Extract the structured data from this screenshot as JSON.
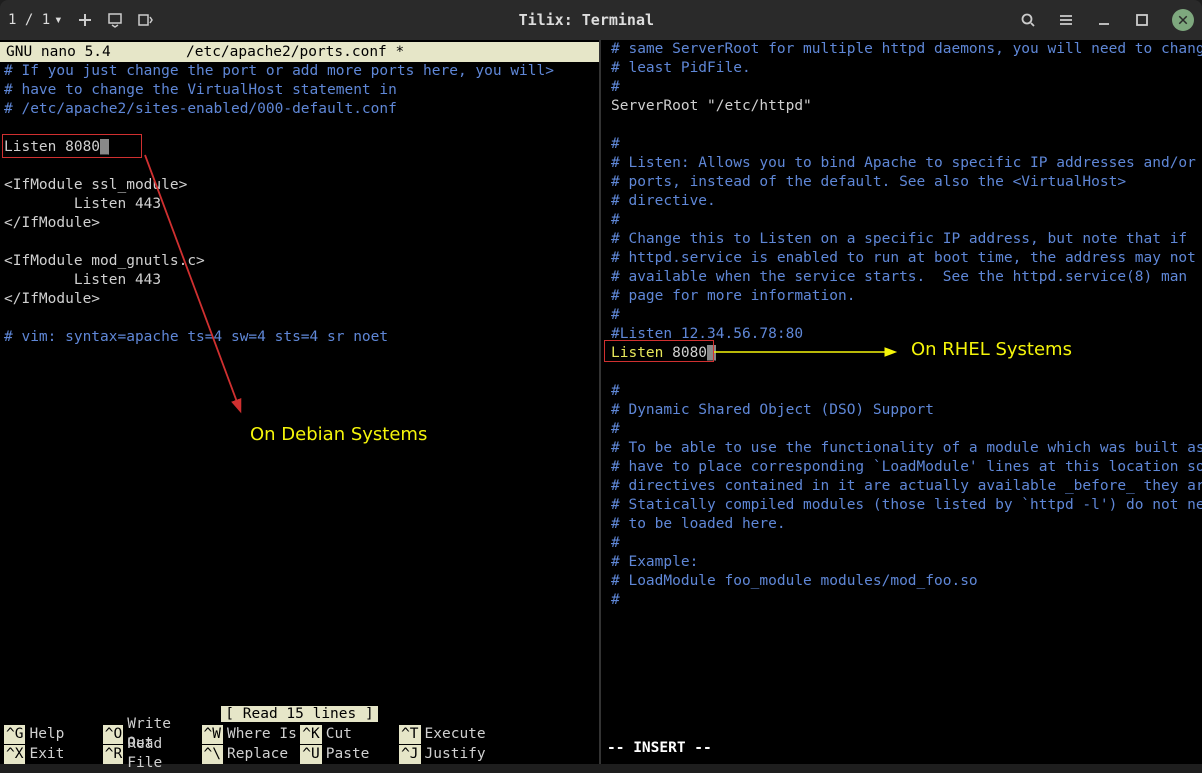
{
  "titlebar": {
    "session": "1 / 1",
    "title": "Tilix: Terminal"
  },
  "left": {
    "nano_app": "  GNU nano 5.4",
    "nano_file": "/etc/apache2/ports.conf *",
    "lines": {
      "c1": "# If you just change the port or add more ports here, you will>",
      "c2": "# have to change the VirtualHost statement in",
      "c3": "# /etc/apache2/sites-enabled/000-default.conf",
      "blank1": " ",
      "listen": "Listen 8080",
      "blank2": " ",
      "if1a": "<IfModule ssl_module>",
      "if1b": "        Listen 443",
      "if1c": "</IfModule>",
      "blank3": " ",
      "if2a": "<IfModule mod_gnutls.c>",
      "if2b": "        Listen 443",
      "if2c": "</IfModule>",
      "blank4": " ",
      "vim": "# vim: syntax=apache ts=4 sw=4 sts=4 sr noet"
    },
    "status": "[ Read 15 lines ]",
    "help": [
      {
        "k": "^G",
        "l": "Help"
      },
      {
        "k": "^O",
        "l": "Write Out"
      },
      {
        "k": "^W",
        "l": "Where Is"
      },
      {
        "k": "^K",
        "l": "Cut"
      },
      {
        "k": "^T",
        "l": "Execute"
      },
      {
        "k": "^X",
        "l": "Exit"
      },
      {
        "k": "^R",
        "l": "Read File"
      },
      {
        "k": "^\\",
        "l": "Replace"
      },
      {
        "k": "^U",
        "l": "Paste"
      },
      {
        "k": "^J",
        "l": "Justify"
      }
    ],
    "annotation": "On Debian Systems"
  },
  "right": {
    "lines": {
      "l1": "# same ServerRoot for multiple httpd daemons, you will need to change at",
      "l2": "# least PidFile.",
      "l3": "#",
      "sr": "ServerRoot \"/etc/httpd\"",
      "blank1": " ",
      "l4": "#",
      "l5": "# Listen: Allows you to bind Apache to specific IP addresses and/or",
      "l6": "# ports, instead of the default. See also the <VirtualHost>",
      "l7": "# directive.",
      "l8": "#",
      "l9": "# Change this to Listen on a specific IP address, but note that if",
      "l10": "# httpd.service is enabled to run at boot time, the address may not be",
      "l11": "# available when the service starts.  See the httpd.service(8) man",
      "l12": "# page for more information.",
      "l13": "#",
      "l14": "#Listen 12.34.56.78:80",
      "listen_kw": "Listen",
      "listen_val": " 8080",
      "blank2": " ",
      "l15": "#",
      "l16": "# Dynamic Shared Object (DSO) Support",
      "l17": "#",
      "l18": "# To be able to use the functionality of a module which was built as a DSO you",
      "l19": "# have to place corresponding `LoadModule' lines at this location so the",
      "l20": "# directives contained in it are actually available _before_ they are used.",
      "l21": "# Statically compiled modules (those listed by `httpd -l') do not need",
      "l22": "# to be loaded here.",
      "l23": "#",
      "l24": "# Example:",
      "l25": "# LoadModule foo_module modules/mod_foo.so",
      "l26": "#"
    },
    "vim_status": "-- INSERT --",
    "annotation": "On RHEL Systems"
  }
}
